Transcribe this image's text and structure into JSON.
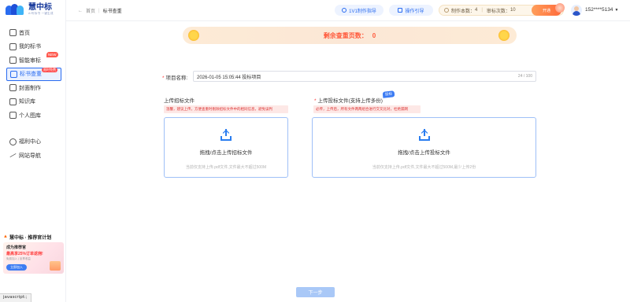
{
  "brand": {
    "name": "慧中标",
    "tagline": "AI写标书 一键生成"
  },
  "sidebar": {
    "items": [
      {
        "label": "首页",
        "icon": "home-icon"
      },
      {
        "label": "我的标书",
        "icon": "document-icon"
      },
      {
        "label": "智能审标",
        "icon": "review-icon",
        "badge": "NEW"
      },
      {
        "label": "标书查重",
        "icon": "duplicate-check-icon",
        "badge": "限时免费",
        "active": true
      },
      {
        "label": "封面制作",
        "icon": "cover-icon"
      },
      {
        "label": "知识库",
        "icon": "knowledge-icon"
      },
      {
        "label": "个人图库",
        "icon": "gallery-icon"
      }
    ],
    "items2": [
      {
        "label": "福利中心",
        "icon": "user-icon"
      },
      {
        "label": "网站导航",
        "icon": "navigation-icon"
      }
    ],
    "promo": {
      "title": "慧中标 · 推荐官计划",
      "line1": "成为推荐官",
      "line2": "最高享25%订单返佣!",
      "line3": "免费加入 | 坐享收益",
      "button": "立即加入"
    }
  },
  "header": {
    "breadcrumb": {
      "home": "首页",
      "sep": "|",
      "current": "标书查重"
    },
    "guide1": "1V1制作指导",
    "guide2": "操作引导",
    "counts": {
      "make_label": "制作本数：",
      "make_value": "4",
      "sep": "|",
      "review_label": "审标次数：",
      "review_value": "10"
    },
    "vip_label": "开通",
    "user": "152****5134"
  },
  "banner": {
    "label": "剩余查重页数：",
    "value": "0"
  },
  "form": {
    "project_label": "项目名称:",
    "project_value": "2026-01-05 15:05:44 投标项目",
    "project_count": "24 / 100",
    "left": {
      "title": "上传招标文件",
      "tip": "温馨，建议上传，方便查重时剔除招标文件中的相同信息，避免误判",
      "drop_main": "拖拽/点击上传招标文件",
      "drop_sub": "当前仅支持上传.pdf文件,文件最大不超过500M"
    },
    "right": {
      "title": "上传投标文件(支持上传多份)",
      "tag": "投标",
      "tip": "必传，上传后，所有文件两两组合进行交叉比对，杜绝漏网",
      "drop_main": "拖拽/点击上传投标文件",
      "drop_sub": "当前仅支持上传.pdf文件,文件最大不超过500M,最少上传2份"
    },
    "next": "下一步"
  },
  "status_bar": "javascript:;",
  "colors": {
    "accent": "#2a6cf0",
    "banner_text": "#ff5a3c",
    "danger": "#ff3b3b"
  }
}
